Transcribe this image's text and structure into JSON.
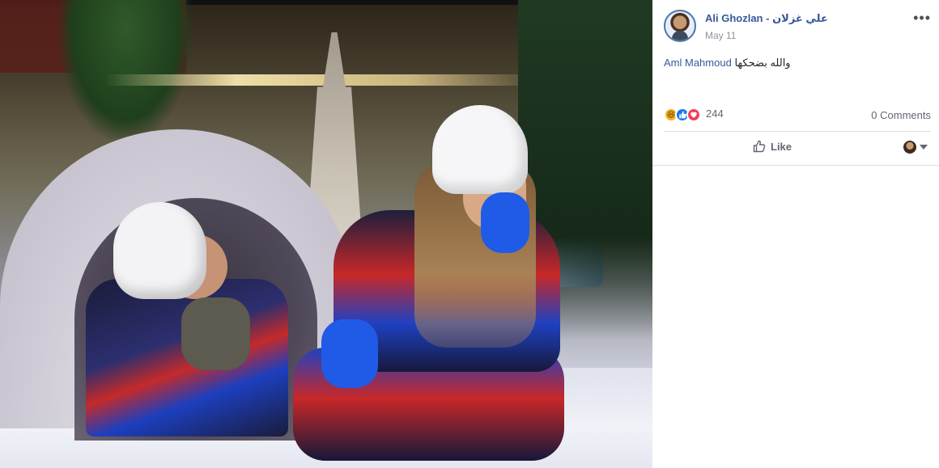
{
  "post": {
    "author": "Ali Ghozlan - علي غزلان",
    "date": "May 11",
    "more": "•••",
    "caption_mention": "Aml Mahmoud",
    "caption_text": "والله بضحكها"
  },
  "reactions": {
    "count": "244",
    "types": [
      "haha",
      "like",
      "love"
    ],
    "comments_label": "0 Comments"
  },
  "actions": {
    "like_label": "Like"
  },
  "colors": {
    "link": "#365899",
    "muted": "#90949c",
    "like_blue": "#1877f2",
    "love_red": "#f33e58",
    "haha_yellow": "#f7b125"
  }
}
